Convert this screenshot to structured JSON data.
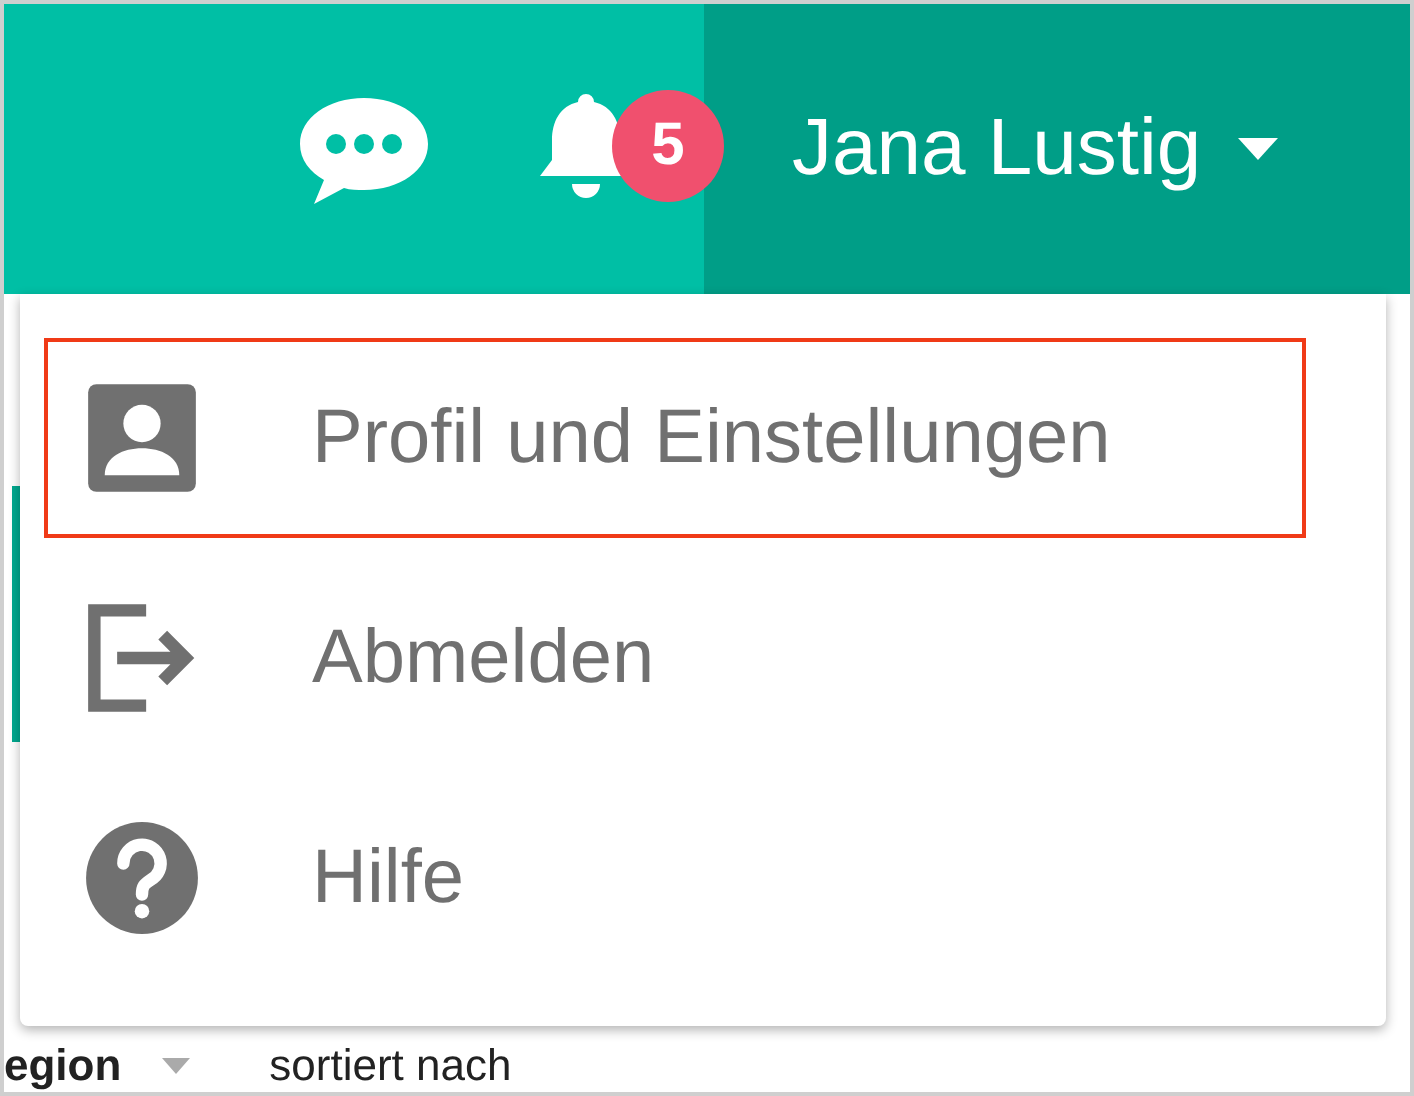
{
  "header": {
    "notifications_badge": "5",
    "user_name": "Jana Lustig"
  },
  "menu": {
    "items": [
      {
        "kind": "profile",
        "label": "Profil und Einstellungen",
        "selected": true
      },
      {
        "kind": "logout",
        "label": "Abmelden",
        "selected": false
      },
      {
        "kind": "help",
        "label": "Hilfe",
        "selected": false
      }
    ]
  },
  "page": {
    "filter_label": "egion",
    "sort_label": "sortiert nach"
  }
}
